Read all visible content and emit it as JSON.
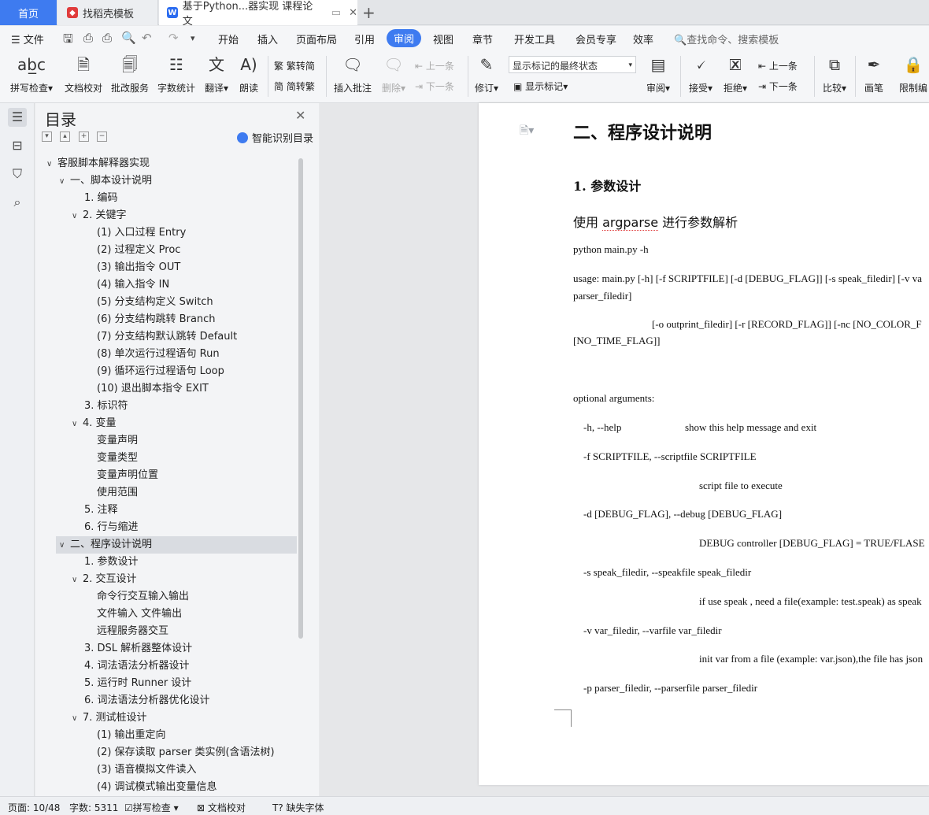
{
  "tabs": {
    "home": "首页",
    "templates": "找稻壳模板",
    "document": "基于Python...器实现 课程论文"
  },
  "menubar": {
    "file": "文件",
    "items": [
      "开始",
      "插入",
      "页面布局",
      "引用",
      "审阅",
      "视图",
      "章节",
      "开发工具",
      "会员专享",
      "效率"
    ],
    "search": "查找命令、搜索模板"
  },
  "ribbon": {
    "spellcheck": "拼写检查",
    "doccheck": "文档校对",
    "review_service": "批改服务",
    "wordcount": "字数统计",
    "translate": "翻译",
    "read_aloud": "朗读",
    "trad": "繁转简",
    "simp": "简转繁",
    "insert_comment": "插入批注",
    "delete": "删除",
    "prev": "上一条",
    "next": "下一条",
    "track": "修订",
    "mark_state": "显示标记的最终状态",
    "show_marks": "显示标记",
    "review": "审阅",
    "accept": "接受",
    "reject": "拒绝",
    "prev2": "上一条",
    "next2": "下一条",
    "compare": "比较",
    "pen": "画笔",
    "restrict": "限制编"
  },
  "toc": {
    "title": "目录",
    "smart": "智能识别目录",
    "items": [
      "客服脚本解释器实现",
      "一、脚本设计说明",
      "1. 编码",
      "2. 关键字",
      "(1)  入口过程 Entry",
      "(2)  过程定义 Proc",
      "(3)  输出指令 OUT",
      "(4)  输入指令 IN",
      "(5)  分支结构定义 Switch",
      "(6)  分支结构跳转 Branch",
      "(7)  分支结构默认跳转 Default",
      "(8)  单次运行过程语句 Run",
      "(9)  循环运行过程语句 Loop",
      "(10)  退出脚本指令 EXIT",
      "3. 标识符",
      "4. 变量",
      "变量声明",
      "变量类型",
      "变量声明位置",
      "使用范围",
      "5. 注释",
      "6. 行与缩进",
      "二、程序设计说明",
      "1. 参数设计",
      "2. 交互设计",
      "命令行交互输入输出",
      "文件输入  文件输出",
      "远程服务器交互",
      "3. DSL 解析器整体设计",
      "4. 词法语法分析器设计",
      "5. 运行时 Runner 设计",
      "6. 词法语法分析器优化设计",
      "7. 测试桩设计",
      "(1)  输出重定向",
      "(2)  保存读取 parser 类实例(含语法树)",
      "(3)  语音模拟文件读入",
      "(4)  调试模式输出变量信息"
    ]
  },
  "page": {
    "h2": "二、程序设计说明",
    "h3": "1.  参数设计",
    "p1a": "使用 ",
    "p1b": "argparse",
    "p1c": " 进行参数解析",
    "l1": "python main.py -h",
    "l2": "usage: main.py [-h] [-f SCRIPTFILE] [-d [DEBUG_FLAG]] [-s speak_filedir] [-v va",
    "l3": "parser_filedir]",
    "l4": "[-o outprint_filedir] [-r [RECORD_FLAG]] [-nc [NO_COLOR_F",
    "l5": "[NO_TIME_FLAG]]",
    "l6": "optional arguments:",
    "l7a": "-h, --help",
    "l7b": "show this help message and exit",
    "l8": "-f SCRIPTFILE, --scriptfile SCRIPTFILE",
    "l9": "script file to execute",
    "l10": "-d [DEBUG_FLAG], --debug [DEBUG_FLAG]",
    "l11": "DEBUG controller [DEBUG_FLAG] = TRUE/FLASE",
    "l12": "-s speak_filedir, --speakfile speak_filedir",
    "l13": "if use speak , need a file(example: test.speak) as speak",
    "l14": "-v var_filedir, --varfile var_filedir",
    "l15": "init var from a file (example: var.json),the file has json",
    "l16": "-p parser_filedir, --parserfile parser_filedir"
  },
  "status": {
    "page": "页面: 10/48",
    "words": "字数: 5311",
    "spell": "拼写检查",
    "check": "文档校对",
    "font": "缺失字体"
  }
}
